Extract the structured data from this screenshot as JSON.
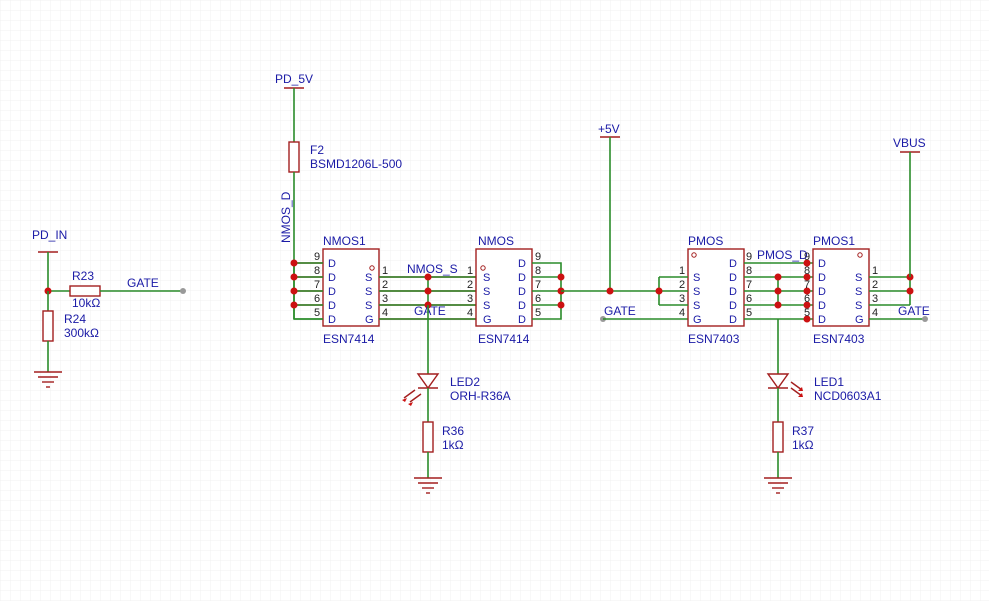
{
  "colors": {
    "wire": "#2a8c2a",
    "part": "#a31f1f",
    "label": "#1a1aa6",
    "junction": "#cc1111",
    "grid": "#f0f0f0"
  },
  "nets": {
    "pd_5v": "PD_5V",
    "pd_in": "PD_IN",
    "plus5v": "+5V",
    "vbus": "VBUS",
    "nmos_d": "NMOS_D",
    "nmos_s": "NMOS_S",
    "pmos_d": "PMOS_D",
    "gate1": "GATE",
    "gate2": "GATE",
    "gate3": "GATE",
    "gate4": "GATE"
  },
  "parts": {
    "f2": {
      "ref": "F2",
      "value": "BSMD1206L-500"
    },
    "r23": {
      "ref": "R23",
      "value": "10kΩ"
    },
    "r24": {
      "ref": "R24",
      "value": "300kΩ"
    },
    "r36": {
      "ref": "R36",
      "value": "1kΩ"
    },
    "r37": {
      "ref": "R37",
      "value": "1kΩ"
    },
    "led2": {
      "ref": "LED2",
      "value": "ORH-R36A"
    },
    "led1": {
      "ref": "LED1",
      "value": "NCD0603A1"
    },
    "nmos1": {
      "ref": "NMOS1",
      "value": "ESN7414"
    },
    "nmos": {
      "ref": "NMOS",
      "value": "ESN7414"
    },
    "pmos": {
      "ref": "PMOS",
      "value": "ESN7403"
    },
    "pmos1": {
      "ref": "PMOS1",
      "value": "ESN7403"
    }
  },
  "ic_pins": {
    "left_numbers": [
      "9",
      "8",
      "7",
      "6",
      "5"
    ],
    "right_numbers": [
      "1",
      "2",
      "3",
      "4"
    ],
    "d_left": [
      "D",
      "D",
      "D",
      "D",
      "D"
    ],
    "s_right": [
      "S",
      "S",
      "S",
      "G"
    ],
    "d_right": [
      "D",
      "D",
      "D",
      "D",
      "D"
    ],
    "s_left": [
      "S",
      "S",
      "S",
      "G"
    ],
    "rev_right_numbers": [
      "9",
      "8",
      "7",
      "6",
      "5"
    ],
    "rev_left_numbers": [
      "1",
      "2",
      "3",
      "4"
    ]
  }
}
